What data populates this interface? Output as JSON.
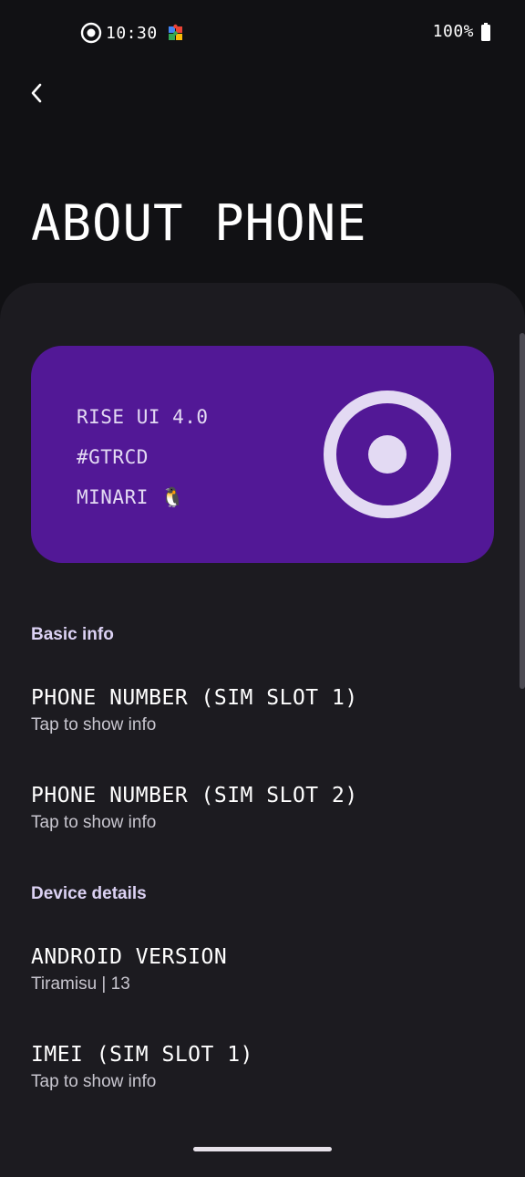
{
  "status_bar": {
    "time": "10:30",
    "battery": "100%",
    "icons": [
      "screen-record-icon",
      "puzzle-icon",
      "battery-icon"
    ]
  },
  "nav": {
    "back_icon": "chevron-left-icon"
  },
  "page": {
    "title": "ABOUT PHONE"
  },
  "hero": {
    "lines": [
      "RISE UI 4.0",
      "#GTRCD",
      "MINARI 🐧"
    ],
    "logo_icon": "rise-circle-logo",
    "background": "#521896",
    "accent": "#e3daf3"
  },
  "sections": [
    {
      "header": "Basic info",
      "items": [
        {
          "title": "PHONE NUMBER (SIM SLOT 1)",
          "subtitle": "Tap to show info"
        },
        {
          "title": "PHONE NUMBER (SIM SLOT 2)",
          "subtitle": "Tap to show info"
        }
      ]
    },
    {
      "header": "Device details",
      "items": [
        {
          "title": "ANDROID VERSION",
          "subtitle": "Tiramisu | 13"
        },
        {
          "title": "IMEI (SIM SLOT 1)",
          "subtitle": "Tap to show info"
        }
      ]
    }
  ],
  "colors": {
    "background": "#111114",
    "panel": "#1c1b20",
    "section_header": "#dcd2f4",
    "subtitle": "#c8c6cf"
  }
}
